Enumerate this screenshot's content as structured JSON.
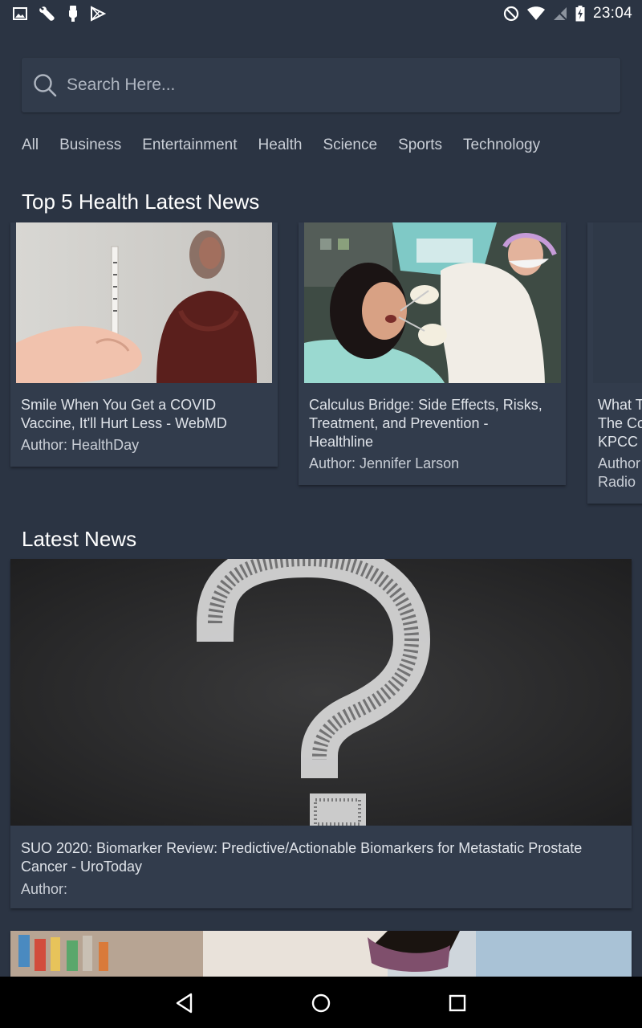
{
  "status_bar": {
    "time": "23:04",
    "left_icons": [
      "image-icon",
      "wrench-icon",
      "usb-icon",
      "play-store-icon"
    ],
    "right_icons": [
      "do-not-disturb-icon",
      "wifi-icon",
      "signal-icon",
      "battery-charging-icon"
    ]
  },
  "search": {
    "placeholder": "Search Here..."
  },
  "categories": [
    "All",
    "Business",
    "Entertainment",
    "Health",
    "Science",
    "Sports",
    "Technology"
  ],
  "top_section": {
    "title": "Top 5 Health Latest News",
    "cards": [
      {
        "title_line1": "Smile When You Get a COVID",
        "title_line2": "Vaccine, It'll Hurt Less - WebMD",
        "author": "Author: HealthDay",
        "image": "vaccine-syringe-photo"
      },
      {
        "title_line1": "Calculus Bridge: Side Effects, Risks,",
        "title_line2": "Treatment, and Prevention -",
        "title_line3": "Healthline",
        "author": "Author: Jennifer Larson",
        "image": "dentist-patient-photo"
      },
      {
        "title_line1": "What T",
        "title_line2": "The Co",
        "title_line3": "KPCC",
        "author_line1": "Author",
        "author_line2": "Radio"
      }
    ]
  },
  "latest_section": {
    "title": "Latest News",
    "cards": [
      {
        "title": "SUO 2020: Biomarker Review: Predictive/Actionable Biomarkers for Metastatic Prostate Cancer - UroToday",
        "author": "Author:",
        "image": "chalk-question-mark-photo"
      },
      {
        "image": "pharmacy-masked-worker-photo"
      }
    ]
  },
  "nav_bar": {
    "buttons": [
      "back-icon",
      "home-icon",
      "recents-icon"
    ]
  }
}
